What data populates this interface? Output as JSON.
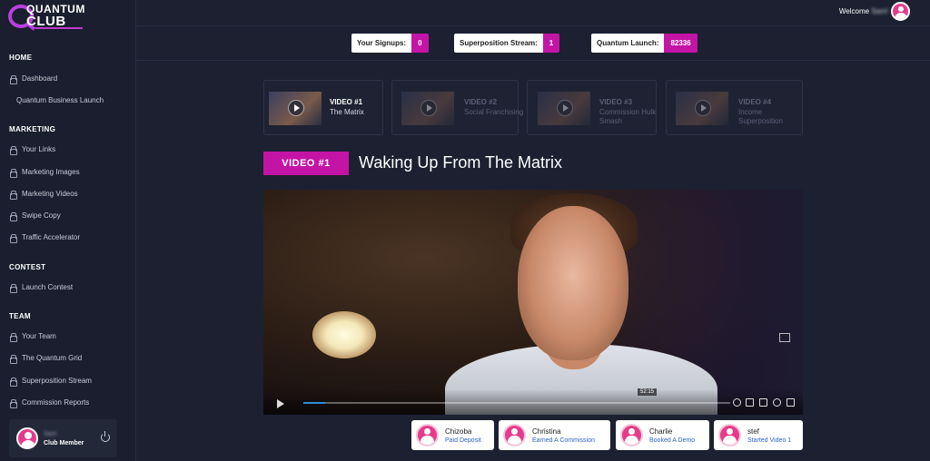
{
  "brand": {
    "line1": "QUANTUM",
    "line2": "CLUB"
  },
  "sidebar": {
    "sections": [
      {
        "title": "HOME",
        "items": [
          "Dashboard",
          "Quantum Business Launch"
        ]
      },
      {
        "title": "MARKETING",
        "items": [
          "Your Links",
          "Marketing Images",
          "Marketing Videos",
          "Swipe Copy",
          "Traffic Accelerator"
        ]
      },
      {
        "title": "CONTEST",
        "items": [
          "Launch Contest"
        ]
      },
      {
        "title": "TEAM",
        "items": [
          "Your Team",
          "The Quantum Grid",
          "Superposition Stream",
          "Commission Reports"
        ]
      }
    ],
    "user": {
      "name": "Sam",
      "role": "Club Member"
    }
  },
  "topbar": {
    "welcome": "Welcome",
    "welcome_name": "Sam!"
  },
  "stats": [
    {
      "label": "Your Signups:",
      "value": "0"
    },
    {
      "label": "Superposition Stream:",
      "value": "1"
    },
    {
      "label": "Quantum Launch:",
      "value": "82336"
    }
  ],
  "video_tabs": [
    {
      "title": "VIDEO #1",
      "sub": "The Matrix"
    },
    {
      "title": "VIDEO #2",
      "sub": "Social Franchising"
    },
    {
      "title": "VIDEO #3",
      "sub": "Commission Hulk Smash"
    },
    {
      "title": "VIDEO #4",
      "sub": "Income Superposition"
    }
  ],
  "current_video": {
    "badge": "VIDEO #1",
    "title": "Waking Up From The Matrix",
    "timestamp": "52:15",
    "progress": 0.05
  },
  "activity_feed": [
    {
      "name": "Chizoba",
      "action": "Paid Deposit"
    },
    {
      "name": "Christina",
      "action": "Earned A Commission"
    },
    {
      "name": "Charlie",
      "action": "Booked A Demo"
    },
    {
      "name": "stef",
      "action": "Started Video 1"
    }
  ],
  "colors": {
    "accent": "#c414a6",
    "background": "#1c2031",
    "link": "#2a63c8"
  }
}
